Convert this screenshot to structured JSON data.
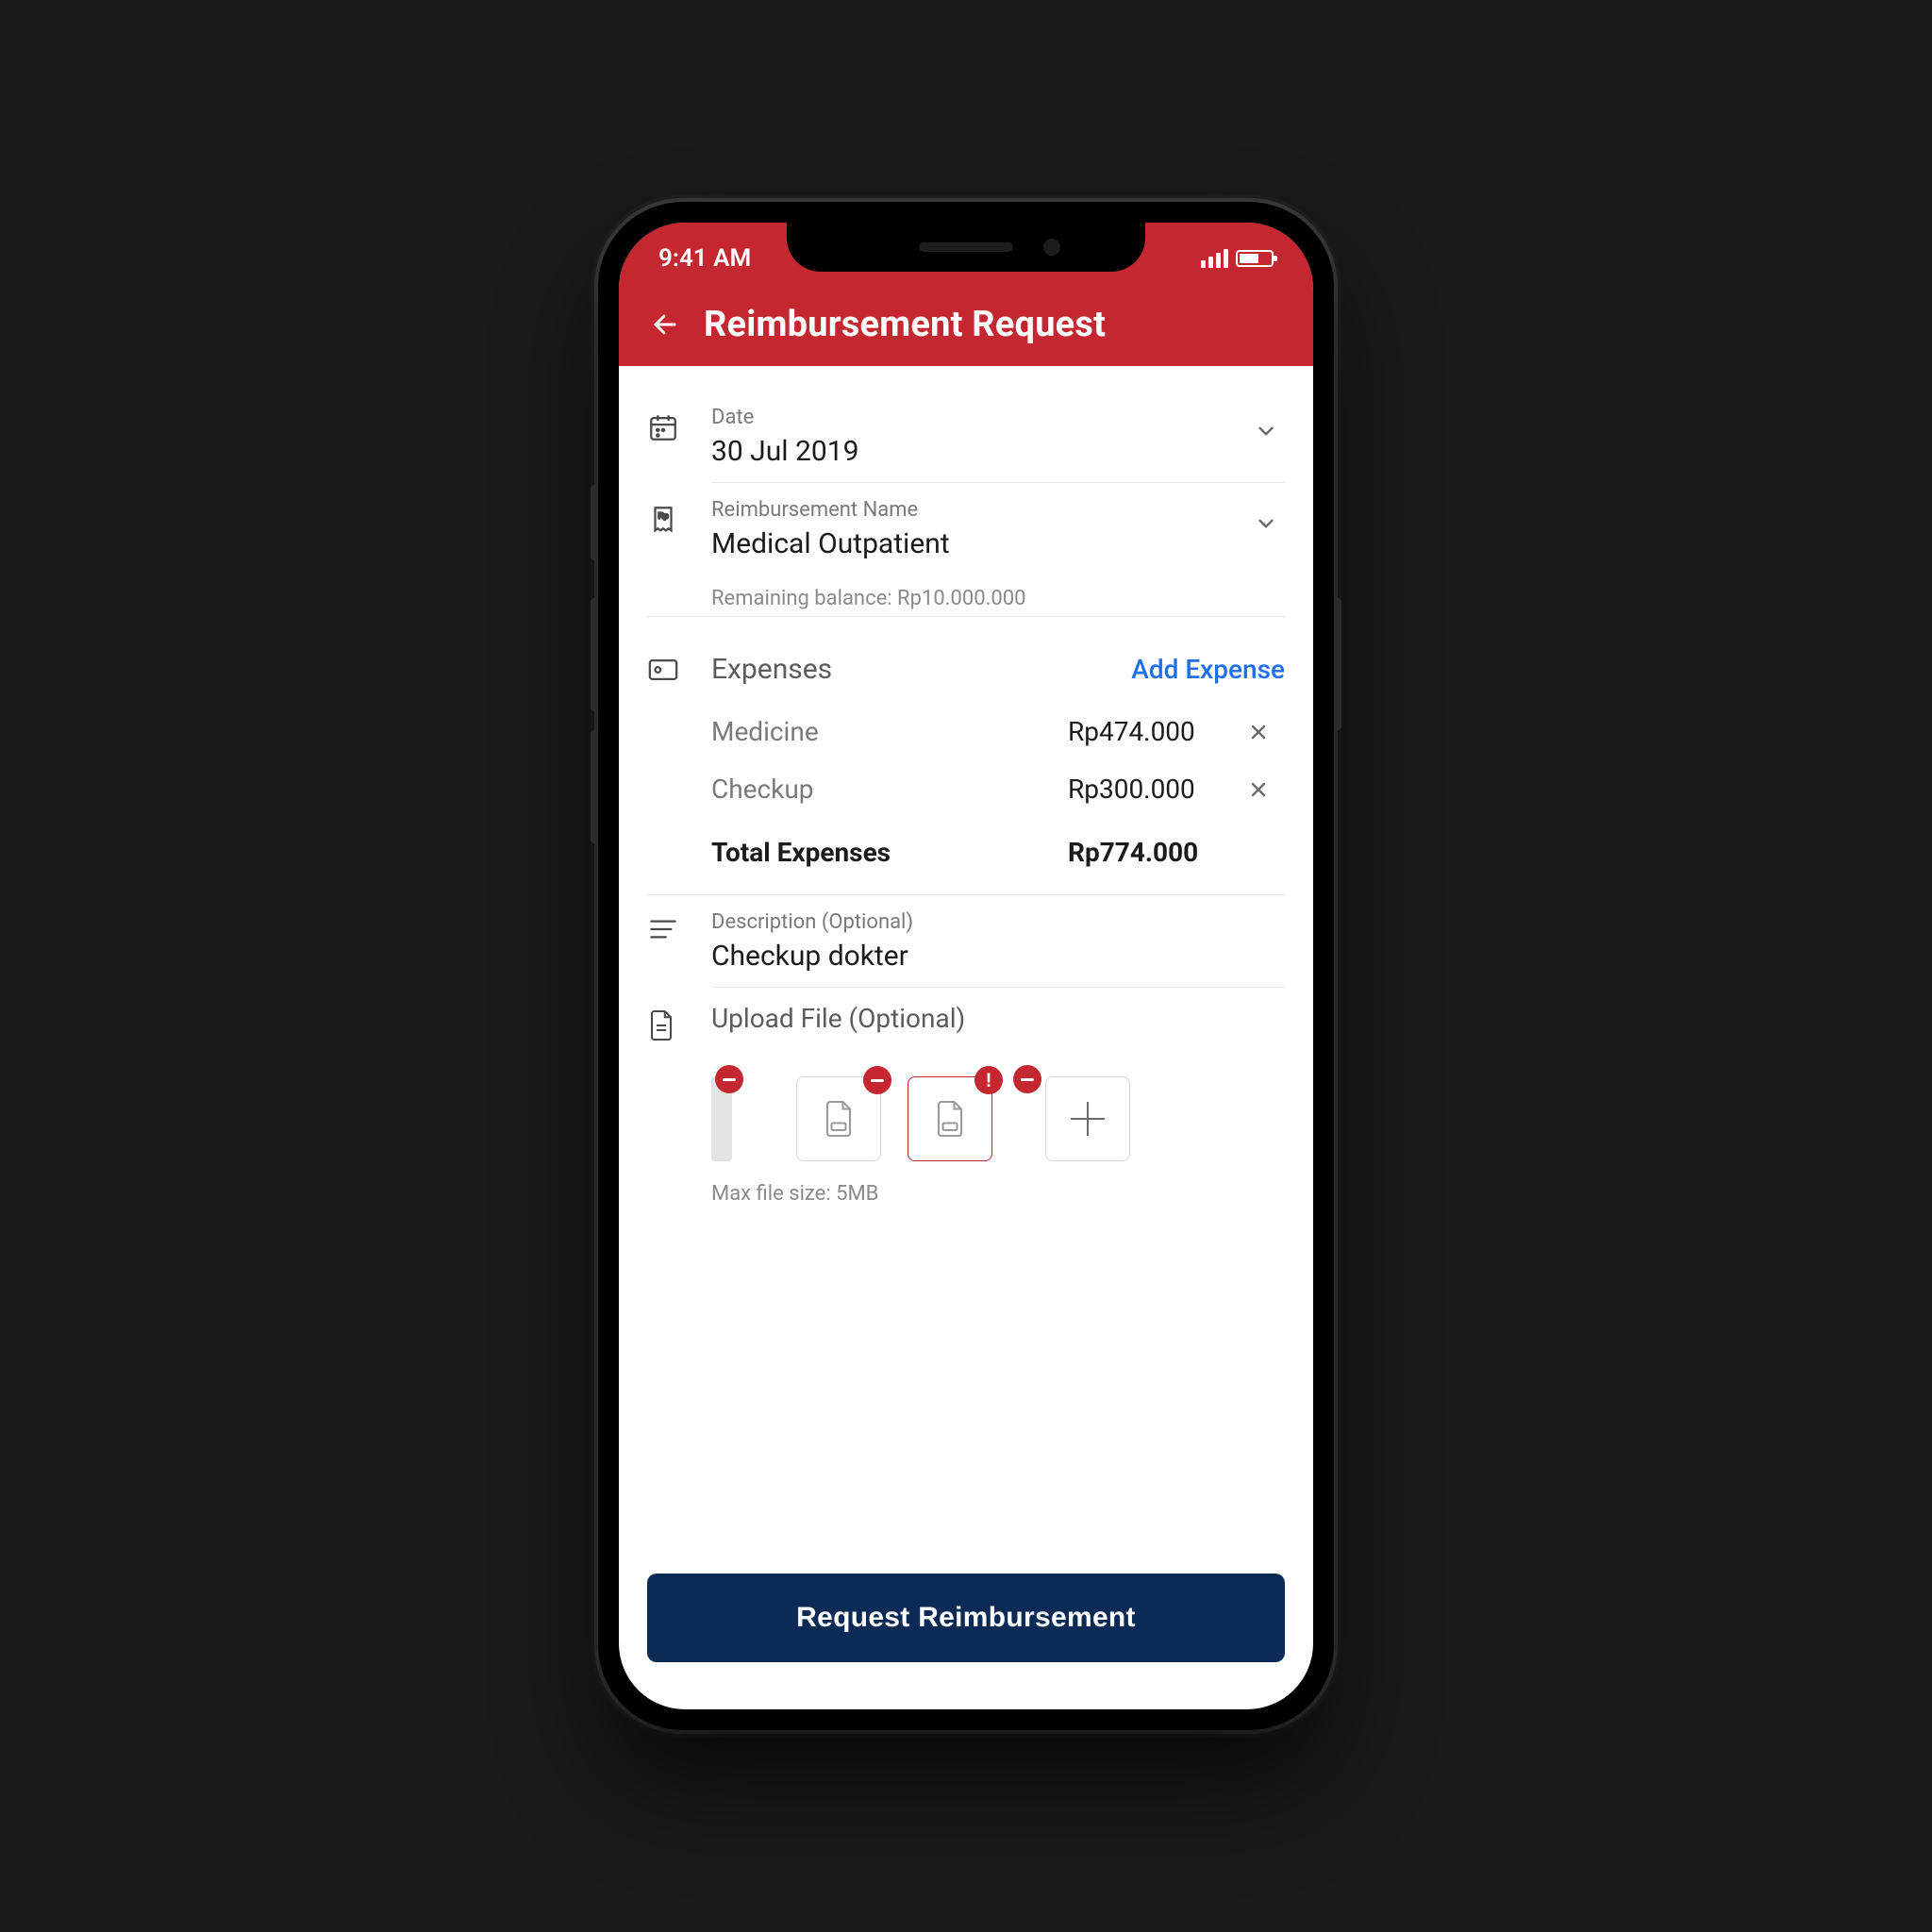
{
  "status": {
    "time": "9:41 AM"
  },
  "header": {
    "title": "Reimbursement Request"
  },
  "date": {
    "label": "Date",
    "value": "30 Jul 2019"
  },
  "reimb": {
    "label": "Reimbursement Name",
    "value": "Medical Outpatient",
    "balance": "Remaining balance: Rp10.000.000"
  },
  "expenses": {
    "title": "Expenses",
    "add_label": "Add Expense",
    "items": [
      {
        "name": "Medicine",
        "amount": "Rp474.000"
      },
      {
        "name": "Checkup",
        "amount": "Rp300.000"
      }
    ],
    "total_label": "Total Expenses",
    "total_amount": "Rp774.000"
  },
  "description": {
    "label": "Description (Optional)",
    "value": "Checkup dokter"
  },
  "upload": {
    "label": "Upload File (Optional)",
    "hint": "Max file size: 5MB"
  },
  "footer": {
    "submit_label": "Request Reimbursement"
  }
}
